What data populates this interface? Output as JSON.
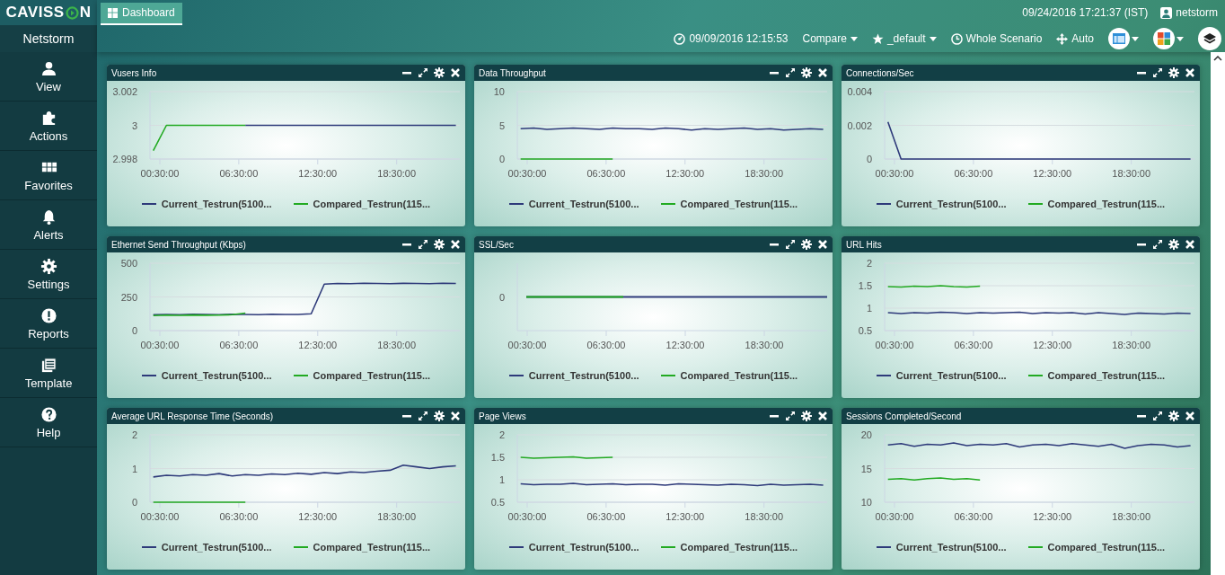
{
  "logo": {
    "text_start": "CAVISS",
    "text_end": "N"
  },
  "tabs": [
    {
      "label": "Dashboard",
      "selected": true
    }
  ],
  "header": {
    "clock": "09/24/2016 17:21:37 (IST)",
    "user": "netstorm"
  },
  "toolbar": {
    "start_time": "09/09/2016 12:15:53",
    "compare": "Compare",
    "favorite": "_default",
    "time_range": "Whole Scenario",
    "layout": "Auto"
  },
  "sidebar": {
    "title": "Netstorm",
    "items": [
      {
        "label": "View"
      },
      {
        "label": "Actions"
      },
      {
        "label": "Favorites"
      },
      {
        "label": "Alerts"
      },
      {
        "label": "Settings"
      },
      {
        "label": "Reports"
      },
      {
        "label": "Template"
      },
      {
        "label": "Help"
      }
    ]
  },
  "panels": [
    {
      "chart_data": {
        "type": "line",
        "title": "Vusers Info",
        "x": [
          0,
          1,
          2,
          3,
          4,
          5,
          6,
          7,
          8,
          9,
          10,
          11,
          12,
          13,
          14,
          15,
          16,
          17,
          18,
          19,
          20,
          21,
          22,
          23
        ],
        "xlim": [
          -0.25,
          23.3
        ],
        "ylim": [
          2.998,
          3.002
        ],
        "yticks": [
          2.998,
          3,
          3.002
        ],
        "xticks": [
          {
            "value": 0.5,
            "label": "00:30:00"
          },
          {
            "value": 6.5,
            "label": "06:30:00"
          },
          {
            "value": 12.5,
            "label": "12:30:00"
          },
          {
            "value": 18.5,
            "label": "18:30:00"
          }
        ],
        "series": [
          {
            "name": "Current_Testrun(5100...",
            "color": "#2e3a7a",
            "values": [
              null,
              null,
              null,
              null,
              null,
              null,
              null,
              3,
              3,
              3,
              3,
              3,
              3,
              3,
              3,
              3,
              3,
              3,
              3,
              3,
              3,
              3,
              3,
              3
            ]
          },
          {
            "name": "Compared_Testrun(115...",
            "color": "#22aa22",
            "values": [
              2.9985,
              3,
              3,
              3,
              3,
              3,
              3,
              3,
              null,
              null,
              null,
              null,
              null,
              null,
              null,
              null,
              null,
              null,
              null,
              null,
              null,
              null,
              null,
              null
            ]
          }
        ]
      }
    },
    {
      "chart_data": {
        "type": "line",
        "title": "Data Throughput",
        "x": [
          0,
          1,
          2,
          3,
          4,
          5,
          6,
          7,
          8,
          9,
          10,
          11,
          12,
          13,
          14,
          15,
          16,
          17,
          18,
          19,
          20,
          21,
          22,
          23
        ],
        "xlim": [
          -0.25,
          23.3
        ],
        "ylim": [
          0,
          10
        ],
        "yticks": [
          0,
          5,
          10
        ],
        "xticks": [
          {
            "value": 0.5,
            "label": "00:30:00"
          },
          {
            "value": 6.5,
            "label": "06:30:00"
          },
          {
            "value": 12.5,
            "label": "12:30:00"
          },
          {
            "value": 18.5,
            "label": "18:30:00"
          }
        ],
        "series": [
          {
            "name": "Current_Testrun(5100...",
            "color": "#2e3a7a",
            "values": [
              4.5,
              4.6,
              4.4,
              4.5,
              4.6,
              4.5,
              4.4,
              4.6,
              4.5,
              4.5,
              4.4,
              4.6,
              4.5,
              4.3,
              4.5,
              4.4,
              4.5,
              4.6,
              4.4,
              4.5,
              4.3,
              4.4,
              4.5,
              4.4
            ]
          },
          {
            "name": "Compared_Testrun(115...",
            "color": "#22aa22",
            "values": [
              0,
              0,
              0,
              0,
              0,
              0,
              0,
              0,
              null,
              null,
              null,
              null,
              null,
              null,
              null,
              null,
              null,
              null,
              null,
              null,
              null,
              null,
              null,
              null
            ]
          }
        ]
      }
    },
    {
      "chart_data": {
        "type": "line",
        "title": "Connections/Sec",
        "x": [
          0,
          1,
          2,
          3,
          4,
          5,
          6,
          7,
          8,
          9,
          10,
          11,
          12,
          13,
          14,
          15,
          16,
          17,
          18,
          19,
          20,
          21,
          22,
          23
        ],
        "xlim": [
          -0.25,
          23.3
        ],
        "ylim": [
          0,
          0.004
        ],
        "yticks": [
          0,
          0.002,
          0.004
        ],
        "xticks": [
          {
            "value": 0.5,
            "label": "00:30:00"
          },
          {
            "value": 6.5,
            "label": "06:30:00"
          },
          {
            "value": 12.5,
            "label": "12:30:00"
          },
          {
            "value": 18.5,
            "label": "18:30:00"
          }
        ],
        "series": [
          {
            "name": "Current_Testrun(5100...",
            "color": "#2e3a7a",
            "values": [
              0.0022,
              0,
              0,
              0,
              0,
              0,
              0,
              0,
              0,
              0,
              0,
              0,
              0,
              0,
              0,
              0,
              0,
              0,
              0,
              0,
              0,
              0,
              0,
              0
            ]
          },
          {
            "name": "Compared_Testrun(115...",
            "color": "#22aa22",
            "values": [
              null,
              null,
              null,
              null,
              null,
              null,
              null,
              null,
              null,
              null,
              null,
              null,
              null,
              null,
              null,
              null,
              null,
              null,
              null,
              null,
              null,
              null,
              null,
              null
            ]
          }
        ]
      }
    },
    {
      "chart_data": {
        "type": "line",
        "title": "Ethernet Send Throughput (Kbps)",
        "x": [
          0,
          1,
          2,
          3,
          4,
          5,
          6,
          7,
          8,
          9,
          10,
          11,
          12,
          13,
          14,
          15,
          16,
          17,
          18,
          19,
          20,
          21,
          22,
          23
        ],
        "xlim": [
          -0.25,
          23.3
        ],
        "ylim": [
          0,
          500
        ],
        "yticks": [
          0,
          250,
          500
        ],
        "xticks": [
          {
            "value": 0.5,
            "label": "00:30:00"
          },
          {
            "value": 6.5,
            "label": "06:30:00"
          },
          {
            "value": 12.5,
            "label": "12:30:00"
          },
          {
            "value": 18.5,
            "label": "18:30:00"
          }
        ],
        "series": [
          {
            "name": "Current_Testrun(5100...",
            "color": "#2e3a7a",
            "values": [
              118,
              120,
              119,
              121,
              120,
              118,
              122,
              120,
              119,
              121,
              120,
              120,
              125,
              345,
              350,
              348,
              352,
              350,
              349,
              351,
              350,
              348,
              352,
              350
            ]
          },
          {
            "name": "Compared_Testrun(115...",
            "color": "#22aa22",
            "values": [
              112,
              115,
              113,
              116,
              114,
              115,
              118,
              130,
              null,
              null,
              null,
              null,
              null,
              null,
              null,
              null,
              null,
              null,
              null,
              null,
              null,
              null,
              null,
              null
            ]
          }
        ]
      }
    },
    {
      "title": "SSL/Sec",
      "y_labels": [
        "0"
      ],
      "x_labels": [
        "00:30:00",
        "06:30:00",
        "12:30:00",
        "18:30:00"
      ],
      "legend": [
        {
          "name": "Current_Testrun(5100...",
          "color": "#2e3a7a"
        },
        {
          "name": "Compared_Testrun(115...",
          "color": "#22aa22"
        }
      ]
    },
    {
      "chart_data": {
        "type": "line",
        "title": "URL Hits",
        "x": [
          0,
          1,
          2,
          3,
          4,
          5,
          6,
          7,
          8,
          9,
          10,
          11,
          12,
          13,
          14,
          15,
          16,
          17,
          18,
          19,
          20,
          21,
          22,
          23
        ],
        "xlim": [
          -0.25,
          23.3
        ],
        "ylim": [
          0.5,
          2
        ],
        "yticks": [
          0.5,
          1,
          1.5,
          2
        ],
        "xticks": [
          {
            "value": 0.5,
            "label": "00:30:00"
          },
          {
            "value": 6.5,
            "label": "06:30:00"
          },
          {
            "value": 12.5,
            "label": "12:30:00"
          },
          {
            "value": 18.5,
            "label": "18:30:00"
          }
        ],
        "series": [
          {
            "name": "Current_Testrun(5100...",
            "color": "#2e3a7a",
            "values": [
              0.9,
              0.88,
              0.9,
              0.89,
              0.91,
              0.9,
              0.88,
              0.9,
              0.89,
              0.9,
              0.91,
              0.88,
              0.9,
              0.89,
              0.9,
              0.87,
              0.9,
              0.88,
              0.86,
              0.89,
              0.88,
              0.87,
              0.89,
              0.88
            ]
          },
          {
            "name": "Compared_Testrun(115...",
            "color": "#22aa22",
            "values": [
              1.48,
              1.47,
              1.49,
              1.48,
              1.5,
              1.48,
              1.47,
              1.49,
              null,
              null,
              null,
              null,
              null,
              null,
              null,
              null,
              null,
              null,
              null,
              null,
              null,
              null,
              null,
              null
            ]
          }
        ]
      }
    },
    {
      "chart_data": {
        "type": "line",
        "title": "Average URL Response Time (Seconds)",
        "x": [
          0,
          1,
          2,
          3,
          4,
          5,
          6,
          7,
          8,
          9,
          10,
          11,
          12,
          13,
          14,
          15,
          16,
          17,
          18,
          19,
          20,
          21,
          22,
          23
        ],
        "xlim": [
          -0.25,
          23.3
        ],
        "ylim": [
          0,
          2
        ],
        "yticks": [
          0,
          1,
          2
        ],
        "xticks": [
          {
            "value": 0.5,
            "label": "00:30:00"
          },
          {
            "value": 6.5,
            "label": "06:30:00"
          },
          {
            "value": 12.5,
            "label": "12:30:00"
          },
          {
            "value": 18.5,
            "label": "18:30:00"
          }
        ],
        "series": [
          {
            "name": "Current_Testrun(5100...",
            "color": "#2e3a7a",
            "values": [
              0.75,
              0.8,
              0.78,
              0.82,
              0.8,
              0.85,
              0.78,
              0.82,
              0.8,
              0.84,
              0.82,
              0.86,
              0.83,
              0.88,
              0.85,
              0.9,
              0.88,
              0.92,
              0.95,
              1.1,
              1.05,
              1.0,
              1.05,
              1.08
            ]
          },
          {
            "name": "Compared_Testrun(115...",
            "color": "#22aa22",
            "values": [
              0,
              0,
              0,
              0,
              0,
              0,
              0,
              0,
              null,
              null,
              null,
              null,
              null,
              null,
              null,
              null,
              null,
              null,
              null,
              null,
              null,
              null,
              null,
              null
            ]
          }
        ]
      }
    },
    {
      "chart_data": {
        "type": "line",
        "title": "Page Views",
        "x": [
          0,
          1,
          2,
          3,
          4,
          5,
          6,
          7,
          8,
          9,
          10,
          11,
          12,
          13,
          14,
          15,
          16,
          17,
          18,
          19,
          20,
          21,
          22,
          23
        ],
        "xlim": [
          -0.25,
          23.3
        ],
        "ylim": [
          0.5,
          2
        ],
        "yticks": [
          0.5,
          1,
          1.5,
          2
        ],
        "xticks": [
          {
            "value": 0.5,
            "label": "00:30:00"
          },
          {
            "value": 6.5,
            "label": "06:30:00"
          },
          {
            "value": 12.5,
            "label": "12:30:00"
          },
          {
            "value": 18.5,
            "label": "18:30:00"
          }
        ],
        "series": [
          {
            "name": "Current_Testrun(5100...",
            "color": "#2e3a7a",
            "values": [
              0.91,
              0.89,
              0.9,
              0.9,
              0.92,
              0.89,
              0.9,
              0.91,
              0.89,
              0.9,
              0.9,
              0.88,
              0.91,
              0.9,
              0.89,
              0.88,
              0.9,
              0.89,
              0.87,
              0.9,
              0.88,
              0.89,
              0.9,
              0.88
            ]
          },
          {
            "name": "Compared_Testrun(115...",
            "color": "#22aa22",
            "values": [
              1.5,
              1.48,
              1.49,
              1.5,
              1.51,
              1.48,
              1.49,
              1.5,
              null,
              null,
              null,
              null,
              null,
              null,
              null,
              null,
              null,
              null,
              null,
              null,
              null,
              null,
              null,
              null
            ]
          }
        ]
      }
    },
    {
      "chart_data": {
        "type": "line",
        "title": "Sessions Completed/Second",
        "x": [
          0,
          1,
          2,
          3,
          4,
          5,
          6,
          7,
          8,
          9,
          10,
          11,
          12,
          13,
          14,
          15,
          16,
          17,
          18,
          19,
          20,
          21,
          22,
          23
        ],
        "xlim": [
          -0.25,
          23.3
        ],
        "ylim": [
          10,
          20
        ],
        "yticks": [
          10,
          15,
          20
        ],
        "xticks": [
          {
            "value": 0.5,
            "label": "00:30:00"
          },
          {
            "value": 6.5,
            "label": "06:30:00"
          },
          {
            "value": 12.5,
            "label": "12:30:00"
          },
          {
            "value": 18.5,
            "label": "18:30:00"
          }
        ],
        "series": [
          {
            "name": "Current_Testrun(5100...",
            "color": "#2e3a7a",
            "values": [
              18.5,
              18.7,
              18.3,
              18.6,
              18.5,
              18.8,
              18.4,
              18.6,
              18.5,
              18.7,
              18.2,
              18.5,
              18.6,
              18.4,
              18.7,
              18.5,
              18.3,
              18.6,
              18.0,
              18.4,
              18.6,
              18.5,
              18.2,
              18.4
            ]
          },
          {
            "name": "Compared_Testrun(115...",
            "color": "#22aa22",
            "values": [
              13.4,
              13.5,
              13.3,
              13.5,
              13.6,
              13.4,
              13.5,
              13.3,
              null,
              null,
              null,
              null,
              null,
              null,
              null,
              null,
              null,
              null,
              null,
              null,
              null,
              null,
              null,
              null
            ]
          }
        ]
      }
    }
  ]
}
